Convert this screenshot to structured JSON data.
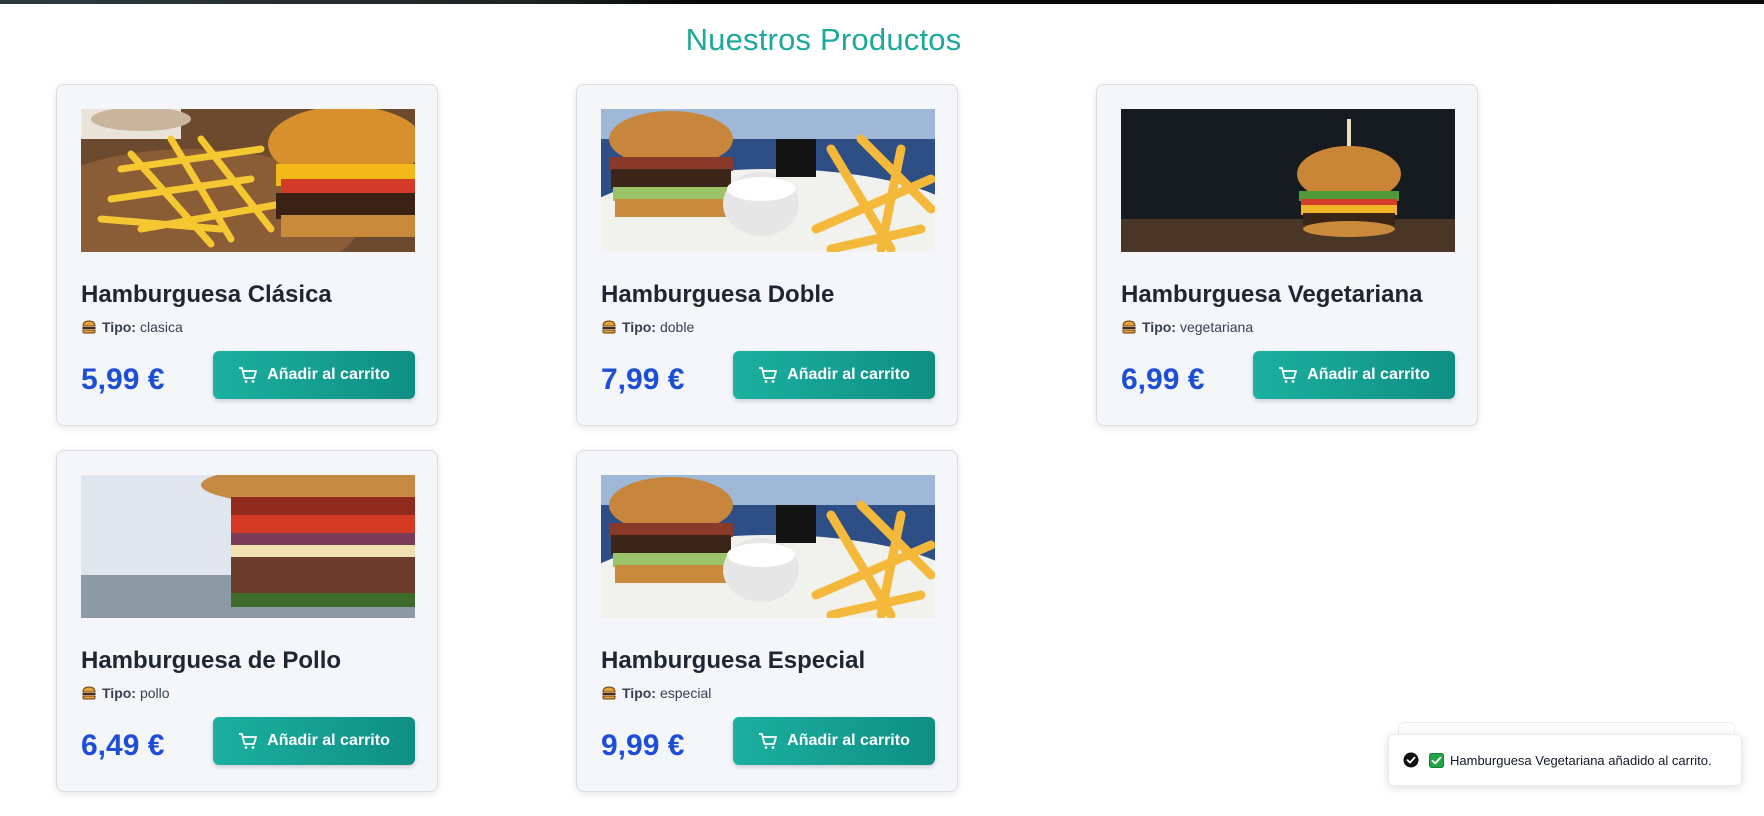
{
  "page": {
    "title": "Nuestros Productos"
  },
  "common": {
    "tipo_label": "Tipo:",
    "add_button_label": "Añadir al carrito"
  },
  "products": [
    {
      "name": "Hamburguesa Clásica",
      "tipo": "clasica",
      "price": "5,99 €",
      "image": "burger-fries-photo"
    },
    {
      "name": "Hamburguesa Doble",
      "tipo": "doble",
      "price": "7,99 €",
      "image": "burger-plate-photo"
    },
    {
      "name": "Hamburguesa Vegetariana",
      "tipo": "vegetariana",
      "price": "6,99 €",
      "image": "burger-dark-photo"
    },
    {
      "name": "Hamburguesa de Pollo",
      "tipo": "pollo",
      "price": "6,49 €",
      "image": "burger-closeup-photo"
    },
    {
      "name": "Hamburguesa Especial",
      "tipo": "especial",
      "price": "9,99 €",
      "image": "burger-plate-photo"
    }
  ],
  "toast": {
    "message": "Hamburguesa Vegetariana añadido al carrito."
  },
  "colors": {
    "accent": "#1aa99a",
    "price": "#1d4ed8",
    "button_start": "#1bb0a0",
    "button_end": "#0f8f84"
  }
}
